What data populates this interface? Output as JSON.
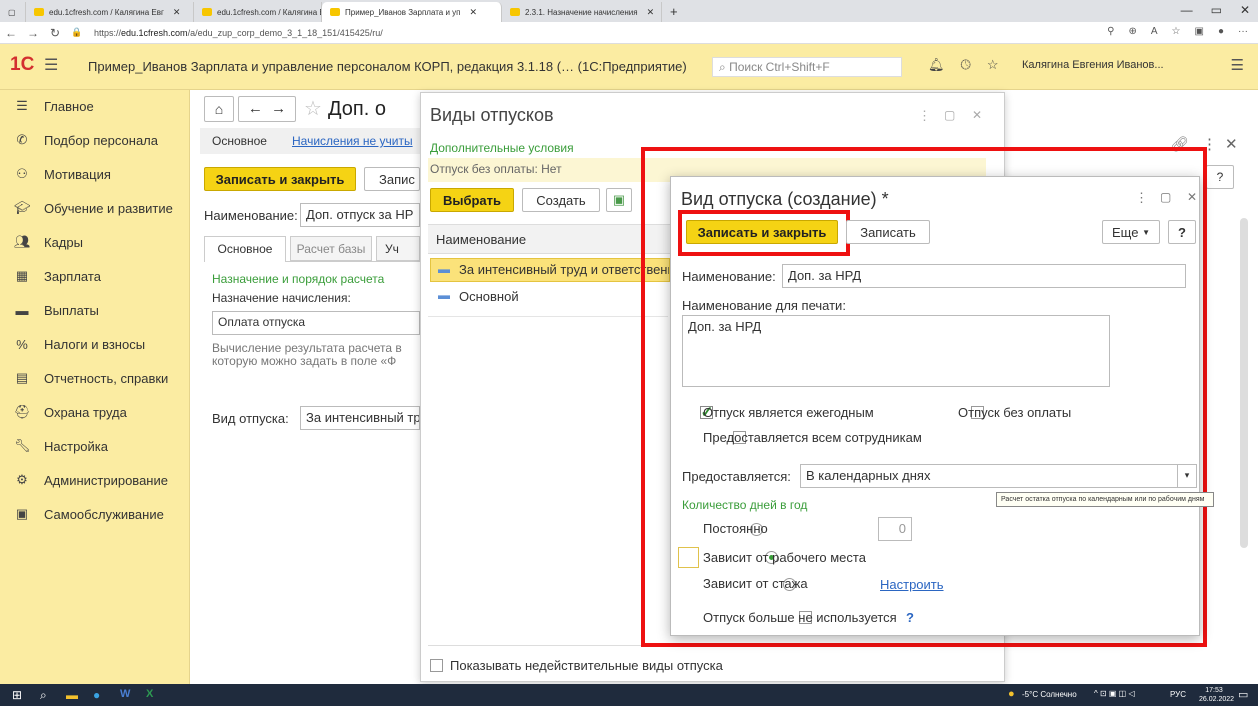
{
  "browser": {
    "tabs": [
      {
        "label": "edu.1cfresh.com / Калягина Евг"
      },
      {
        "label": "edu.1cfresh.com / Калягина Евг"
      },
      {
        "label": "Пример_Иванов Зарплата и уп"
      },
      {
        "label": "2.3.1. Назначение начисления"
      }
    ],
    "url_prefix": "https://",
    "url_host": "edu.1cfresh.com",
    "url_path": "/a/edu_zup_corp_demo_3_1_18_151/415425/ru/"
  },
  "app": {
    "logo": "1С",
    "title": "Пример_Иванов Зарплата и управление персоналом КОРП, редакция 3.1.18 (…  (1С:Предприятие)",
    "search_placeholder": "Поиск Ctrl+Shift+F",
    "user": "Калягина Евгения Иванов..."
  },
  "sidebar": {
    "items": [
      {
        "label": "Главное"
      },
      {
        "label": "Подбор персонала"
      },
      {
        "label": "Мотивация"
      },
      {
        "label": "Обучение и развитие"
      },
      {
        "label": "Кадры"
      },
      {
        "label": "Зарплата"
      },
      {
        "label": "Выплаты"
      },
      {
        "label": "Налоги и взносы"
      },
      {
        "label": "Отчетность, справки"
      },
      {
        "label": "Охрана труда"
      },
      {
        "label": "Настройка"
      },
      {
        "label": "Администрирование"
      },
      {
        "label": "Самообслуживание"
      }
    ]
  },
  "bgform": {
    "title": "Доп. о",
    "tab_main": "Основное",
    "tab_link": "Начисления не учиты",
    "save_close": "Записать и закрыть",
    "save": "Запис",
    "name_label": "Наименование:",
    "name_value": "Доп. отпуск за НР",
    "subtab1": "Основное",
    "subtab2": "Расчет базы",
    "subtab3": "Уч",
    "section": "Назначение и порядок расчета",
    "purpose_label": "Назначение начисления:",
    "purpose_value": "Оплата отпуска",
    "calc_text1": "Вычисление результата расчета в",
    "calc_text2": "которую можно задать в поле «Ф",
    "vac_label": "Вид отпуска:",
    "vac_value": "За интенсивный тр"
  },
  "vwin": {
    "title": "Виды отпусков",
    "extra_conditions": "Дополнительные условия",
    "filter": "Отпуск без оплаты: Нет",
    "select": "Выбрать",
    "create": "Создать",
    "col_name": "Наименование",
    "rows": [
      {
        "label": "За интенсивный труд и ответственн"
      },
      {
        "label": "Основной"
      }
    ],
    "show_invalid": "Показывать недействительные виды отпуска"
  },
  "dialog": {
    "title": "Вид отпуска (создание) *",
    "save_close": "Записать и закрыть",
    "save": "Записать",
    "more": "Еще",
    "help": "?",
    "name_label": "Наименование:",
    "name_value": "Доп. за НРД",
    "print_label": "Наименование для печати:",
    "print_value": "Доп. за НРД",
    "annual": "Отпуск является ежегодным",
    "unpaid": "Отпуск без оплаты",
    "all_employees": "Предоставляется всем сотрудникам",
    "provided_label": "Предоставляется:",
    "provided_value": "В календарных днях",
    "tooltip": "Расчет остатка отпуска по календарным или по рабочим дням",
    "days_section": "Количество дней в год",
    "opt_constant": "Постоянно",
    "const_value": "0",
    "opt_workplace": "Зависит от рабочего места",
    "opt_seniority": "Зависит от стажа",
    "configure": "Настроить",
    "not_used": "Отпуск больше не используется",
    "not_used_help": "?"
  },
  "taskbar": {
    "weather": "-5°C Солнечно",
    "lang": "РУС",
    "time": "17:53",
    "date": "26.02.2022"
  },
  "colors": {
    "accent_yellow": "#f5d314",
    "sidebar_bg": "#fbeca2",
    "highlight_red": "#ee1111",
    "section_green": "#3a9d3a",
    "link_blue": "#2b66c2"
  }
}
